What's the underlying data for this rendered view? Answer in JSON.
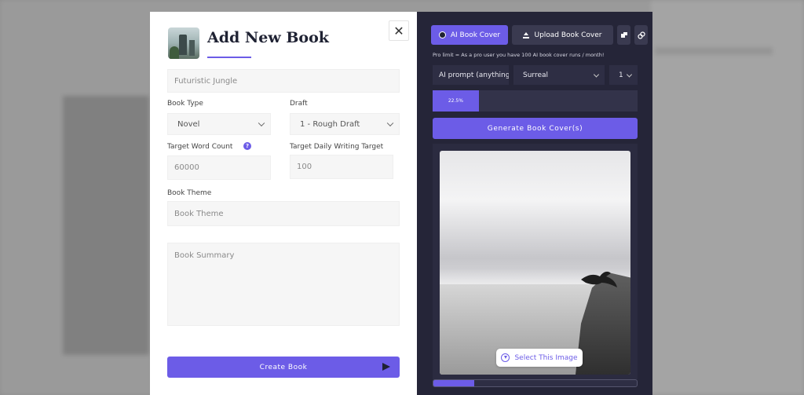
{
  "modal": {
    "title": "Add New Book",
    "close_symbol": "✕",
    "book_title_value": "Futuristic Jungle",
    "book_type": {
      "label": "Book Type",
      "value": "Novel"
    },
    "draft": {
      "label": "Draft",
      "value": "1 - Rough Draft"
    },
    "target_word_count": {
      "label": "Target Word Count",
      "value": "60000",
      "help_symbol": "?"
    },
    "daily_target": {
      "label": "Target Daily Writing Target",
      "value": "100"
    },
    "book_theme": {
      "label": "Book Theme",
      "placeholder": "Book Theme"
    },
    "book_summary": {
      "placeholder": "Book Summary"
    },
    "create_button": "Create Book"
  },
  "cover_panel": {
    "tabs": {
      "ai": "AI Book Cover",
      "upload": "Upload Book Cover"
    },
    "pro_note": "Pro limit = As a pro user you have 100 AI book cover runs / month!",
    "prompt_value": "AI prompt (anything",
    "style_value": "Surreal",
    "count_value": "1",
    "progress": {
      "percent": 22.5,
      "label": "22.5%"
    },
    "generate_button": "Generate Book Cover(s)",
    "select_image_button": "Select This Image",
    "bottom_progress_percent": 20
  },
  "colors": {
    "accent": "#6c5ce7",
    "panel_dark": "#252538"
  }
}
